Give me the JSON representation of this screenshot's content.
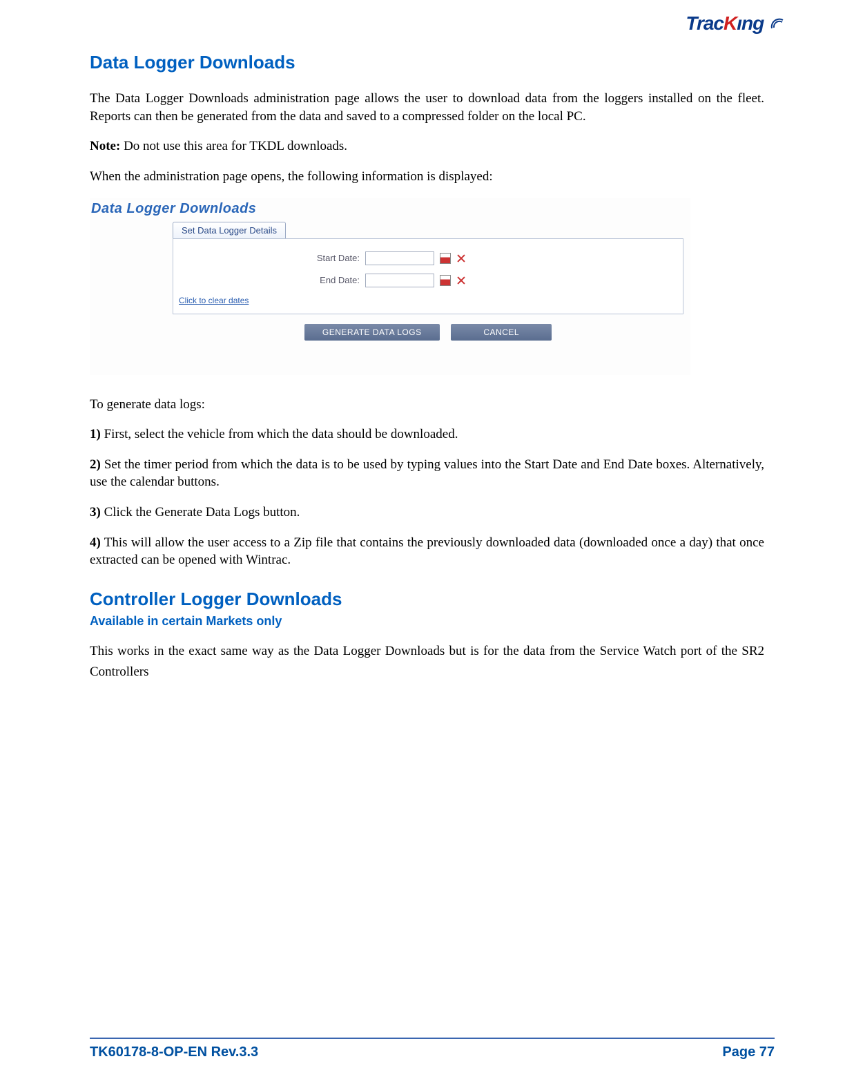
{
  "logo": {
    "part1": "Trac",
    "part2": "K",
    "part3": "ıng"
  },
  "section1": {
    "heading": "Data Logger Downloads",
    "p1": "The Data Logger Downloads administration page allows the user to download data from the loggers installed on the fleet. Reports can then be generated from the data and saved to a compressed folder on the local PC.",
    "note_label": "Note:",
    "note_text": " Do not use this area for TKDL downloads.",
    "p3": "When the administration page opens, the following information is displayed:"
  },
  "screenshot": {
    "title": "Data Logger Downloads",
    "tab": "Set Data Logger Details",
    "start_label": "Start Date:",
    "end_label": "End Date:",
    "start_value": "",
    "end_value": "",
    "clear_link": "Click to clear dates",
    "btn_generate": "GENERATE DATA LOGS",
    "btn_cancel": "CANCEL"
  },
  "steps": {
    "intro": "To generate data logs:",
    "s1_label": "1)",
    "s1": " First, select the vehicle from which the data should be downloaded.",
    "s2_label": "2)",
    "s2": " Set the timer period from which the data is to be used by typing values into the Start Date and End Date boxes. Alternatively, use the calendar buttons.",
    "s3_label": "3)",
    "s3": " Click the Generate Data Logs button.",
    "s4_label": "4)",
    "s4": " This will allow the user access to a Zip file that contains the previously downloaded data (downloaded once a day) that once extracted can be opened with Wintrac."
  },
  "section2": {
    "heading": "Controller Logger Downloads",
    "sub": "Available in certain Markets only",
    "body": "This works in the exact same way as the Data Logger Downloads but is for the data from the Service Watch port of the SR2 Controllers"
  },
  "footer": {
    "doc": "TK60178-8-OP-EN Rev.3.3",
    "page_label": "Page  ",
    "page_num": "77"
  }
}
